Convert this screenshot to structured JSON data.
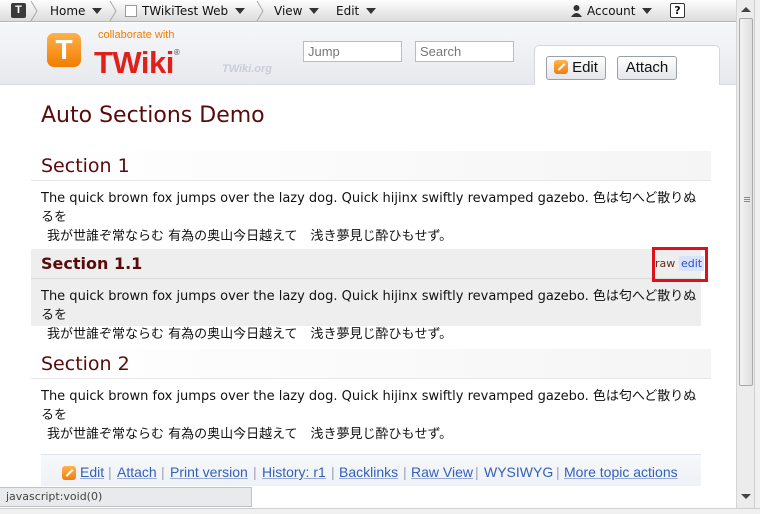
{
  "menubar": {
    "logo": "T",
    "home": "Home",
    "web": "TWikiTest Web",
    "view": "View",
    "edit": "Edit",
    "account": "Account",
    "help": "?"
  },
  "header": {
    "tagline": "collaborate with",
    "brand": "TWiki",
    "reg": "®",
    "org": "TWiki.org",
    "jump_placeholder": "Jump",
    "search_placeholder": "Search",
    "edit_button": "Edit",
    "attach_button": "Attach"
  },
  "page": {
    "title": "Auto Sections Demo",
    "sections": [
      {
        "heading": "Section 1",
        "line1": "The quick brown fox jumps over the lazy dog. Quick hijinx swiftly revamped gazebo. 色は匂へど散りぬるを",
        "line2": "我が世誰ぞ常ならむ 有為の奥山今日越えて　浅き夢見じ酔ひもせず。"
      },
      {
        "heading": "Section 1.1",
        "raw": "raw",
        "edit": "edit",
        "line1": "The quick brown fox jumps over the lazy dog. Quick hijinx swiftly revamped gazebo. 色は匂へど散りぬるを",
        "line2": "我が世誰ぞ常ならむ 有為の奥山今日越えて　浅き夢見じ酔ひもせず。"
      },
      {
        "heading": "Section 2",
        "line1": "The quick brown fox jumps over the lazy dog. Quick hijinx swiftly revamped gazebo. 色は匂へど散りぬるを",
        "line2": "我が世誰ぞ常ならむ 有為の奥山今日越えて　浅き夢見じ酔ひもせず。"
      }
    ]
  },
  "actions": {
    "edit": "Edit",
    "attach": "Attach",
    "print": "Print version",
    "history": "History: r1",
    "backlinks": "Backlinks",
    "raw": "Raw View",
    "wysiwyg": "WYSIWYG",
    "more": "More topic actions",
    "separator": "|"
  },
  "status": {
    "text": "javascript:void(0)"
  },
  "colors": {
    "heading": "#5a0a0a",
    "link": "#3360b8",
    "highlight_box": "#e0101a",
    "brand_red": "#e0201b",
    "brand_orange": "#f07d00"
  }
}
